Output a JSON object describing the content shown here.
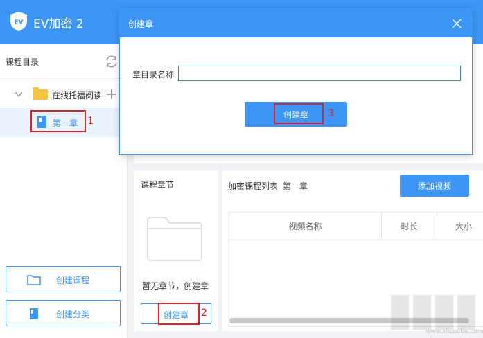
{
  "app": {
    "title": "EV加密 2"
  },
  "sidebar": {
    "header_label": "课程目录",
    "course_name": "在线托福阅读",
    "chapter_label": "第一章",
    "annotation_1": "1",
    "create_course_label": "创建课程",
    "create_category_label": "创建分类"
  },
  "chapter_panel": {
    "title": "课程章节",
    "empty_text": "暂无章节，创建章",
    "create_chapter_label": "创建章",
    "annotation_2": "2"
  },
  "list_panel": {
    "title": "加密课程列表",
    "subtitle": "第一章",
    "add_video_label": "添加视频",
    "columns": [
      "视频名称",
      "时长",
      "大小"
    ]
  },
  "dialog": {
    "title": "创建章",
    "field_label": "章目录名称",
    "field_value": "",
    "button_label": "创建章",
    "annotation_3": "3"
  },
  "colors": {
    "accent": "#3d96f5",
    "annotation": "#e0202a",
    "folder": "#f5c342"
  },
  "watermark_url": "www.xiazaiba.com"
}
